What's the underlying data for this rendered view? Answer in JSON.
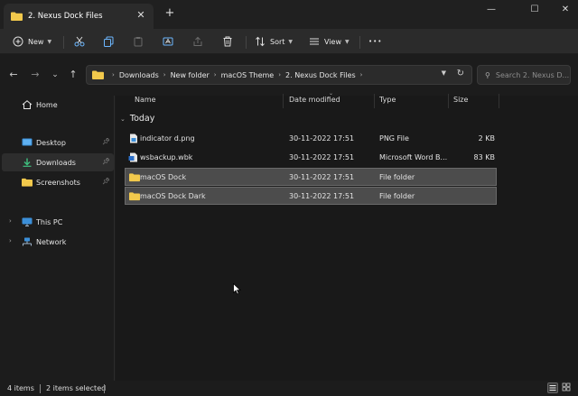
{
  "tab": {
    "title": "2. Nexus Dock Files",
    "close_glyph": "✕",
    "new_glyph": "+"
  },
  "window": {
    "minimize_glyph": "—",
    "maximize_glyph": "☐",
    "close_glyph": "✕"
  },
  "toolbar": {
    "new_label": "New",
    "sort_label": "Sort",
    "view_label": "View",
    "more_glyph": "•••"
  },
  "nav": {
    "back": "←",
    "forward": "→",
    "recent": "⌄",
    "up": "↑"
  },
  "address": {
    "crumbs": [
      "Downloads",
      "New folder",
      "macOS Theme",
      "2. Nexus Dock Files"
    ],
    "separator": "›"
  },
  "search": {
    "placeholder": "Search 2. Nexus D..."
  },
  "sidebar": {
    "items": [
      {
        "label": "Home",
        "icon": "home-icon"
      },
      {
        "label": "Desktop",
        "icon": "desktop-icon",
        "pinned": true
      },
      {
        "label": "Downloads",
        "icon": "download-icon",
        "pinned": true,
        "active": true
      },
      {
        "label": "Screenshots",
        "icon": "folder-icon",
        "pinned": true
      },
      {
        "label": "This PC",
        "icon": "computer-icon",
        "expandable": true
      },
      {
        "label": "Network",
        "icon": "network-icon",
        "expandable": true
      }
    ]
  },
  "columns": {
    "name": "Name",
    "date": "Date modified",
    "type": "Type",
    "size": "Size"
  },
  "group": {
    "label": "Today"
  },
  "files": [
    {
      "name": "indicator d.png",
      "date": "30-11-2022 17:51",
      "type": "PNG File",
      "size": "2 KB",
      "icon": "image-file-icon",
      "selected": false
    },
    {
      "name": "wsbackup.wbk",
      "date": "30-11-2022 17:51",
      "type": "Microsoft Word B...",
      "size": "83 KB",
      "icon": "word-file-icon",
      "selected": false
    },
    {
      "name": "macOS Dock",
      "date": "30-11-2022 17:51",
      "type": "File folder",
      "size": "",
      "icon": "folder-icon",
      "selected": true
    },
    {
      "name": "macOS Dock Dark",
      "date": "30-11-2022 17:51",
      "type": "File folder",
      "size": "",
      "icon": "folder-icon",
      "selected": true
    }
  ],
  "status": {
    "count": "4 items",
    "selected": "2 items selected"
  },
  "colors": {
    "folder": "#f2c94c",
    "accent": "#4cc2ff",
    "selection": "#4c4c4c"
  }
}
